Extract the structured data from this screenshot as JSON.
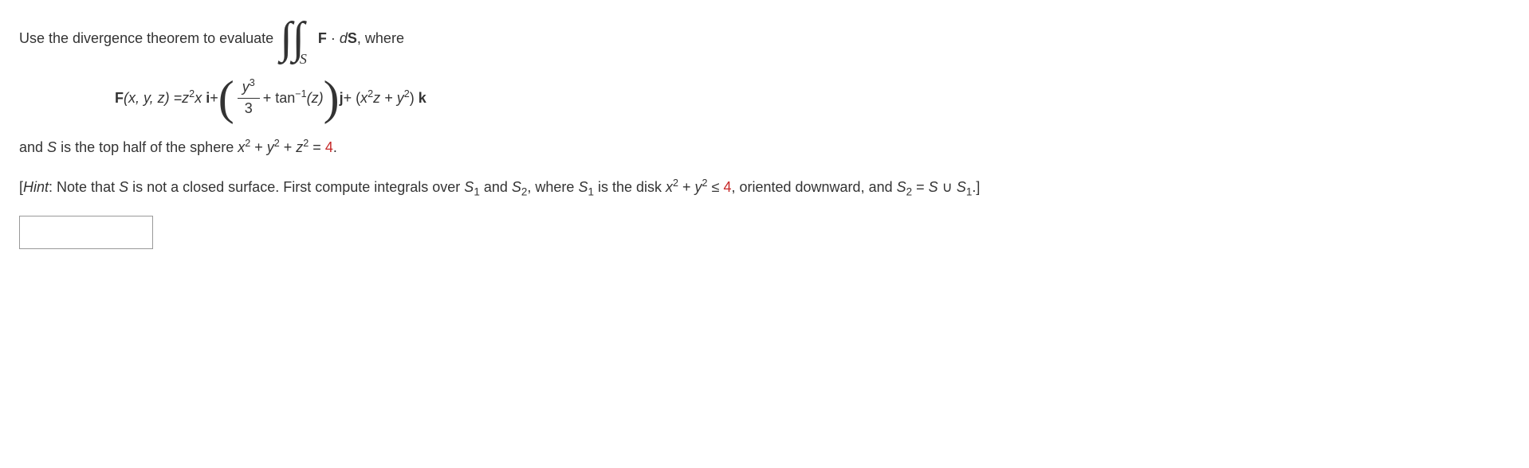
{
  "line1": {
    "pre": "Use the divergence theorem to evaluate ",
    "int_sub": "S",
    "F": "F",
    "dot": " · ",
    "dS_d": "d",
    "dS_S": "S",
    "post": ", where"
  },
  "formula": {
    "lhs_F": "F",
    "lhs_args": "(x, y, z) = ",
    "t1a": "z",
    "t1exp": "2",
    "t1b": "x",
    "i": "i",
    "plus1": " + ",
    "frac_num_y": "y",
    "frac_num_exp": "3",
    "frac_den": "3",
    "plus2": " + tan",
    "tan_exp": "−1",
    "tan_arg": "(z)",
    "j": "j",
    "plus3": " + (",
    "t3_x": "x",
    "t3_xexp": "2",
    "t3_z": "z + ",
    "t3_y": "y",
    "t3_yexp": "2",
    "t3_close": ")",
    "k": "k"
  },
  "line3": {
    "pre": "and ",
    "S": "S",
    "mid": " is the top half of the sphere ",
    "x": "x",
    "e2a": "2",
    "p1": " + ",
    "y": "y",
    "e2b": "2",
    "p2": " + ",
    "z": "z",
    "e2c": "2",
    "eq": " = ",
    "val": "4",
    "dot": "."
  },
  "hint": {
    "open": "[",
    "hint_word": "Hint",
    "t1": ": Note that ",
    "S": "S",
    "t2": " is not a closed surface. First compute integrals over ",
    "S1": "S",
    "sub1": "1",
    "t3": " and ",
    "S2": "S",
    "sub2": "2",
    "t4": ", where ",
    "S1b": "S",
    "sub1b": "1",
    "t5": " is the disk ",
    "x": "x",
    "e2a": "2",
    "p1": " + ",
    "y": "y",
    "e2b": "2",
    "le": " ≤ ",
    "four": "4",
    "t6": ", oriented downward, and ",
    "S2b": "S",
    "sub2b": "2",
    "eq": " = ",
    "Su": "S",
    "cup": " ∪ ",
    "S1c": "S",
    "sub1c": "1",
    "close": ".]"
  },
  "answer": {
    "value": ""
  }
}
